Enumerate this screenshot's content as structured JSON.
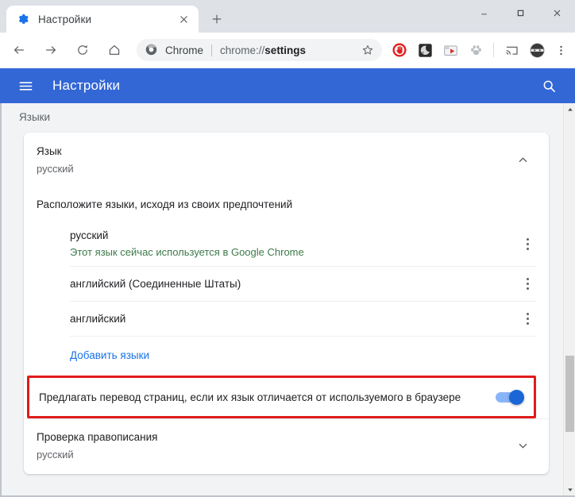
{
  "window": {
    "minimize_label": "—",
    "maximize_label": "□",
    "close_label": "×"
  },
  "tabstrip": {
    "tab": {
      "title": "Настройки",
      "favicon_name": "settings-gear-favicon",
      "close_label": "×"
    },
    "new_tab_label": "+"
  },
  "toolbar": {
    "back_label": "←",
    "forward_label": "→",
    "reload_label": "⟳",
    "home_label": "⌂",
    "omnibox": {
      "site_icon_name": "chrome-logo-icon",
      "site_label": "Chrome",
      "url_prefix": "chrome://",
      "url_bold": "settings",
      "url_full": "chrome://settings",
      "star_label": "☆"
    },
    "extensions": [
      {
        "name": "adblock-extension-icon",
        "color": "#e02020"
      },
      {
        "name": "dark-reader-extension-icon",
        "color": "#2b2b2b"
      },
      {
        "name": "screenshot-extension-icon",
        "color": "#d93025"
      },
      {
        "name": "paw-extension-icon",
        "color": "#9aa0a6"
      }
    ],
    "cast_icon_name": "cast-icon",
    "profile_icon_name": "profile-avatar-icon",
    "menu_label": "⋮"
  },
  "settings_header": {
    "menu_icon_name": "hamburger-menu-icon",
    "title": "Настройки",
    "search_icon_name": "search-icon",
    "accent_color": "#3367d6"
  },
  "page": {
    "section_title": "Языки",
    "language_card": {
      "title": "Язык",
      "subtitle": "русский",
      "collapse_icon_name": "chevron-up-icon",
      "order_hint": "Расположите языки, исходя из своих предпочтений",
      "languages": [
        {
          "name": "русский",
          "note": "Этот язык сейчас используется в Google Chrome",
          "note_color": "#3d7a4a",
          "menu_icon_name": "more-vert-icon"
        },
        {
          "name": "английский (Соединенные Штаты)",
          "note": "",
          "menu_icon_name": "more-vert-icon"
        },
        {
          "name": "английский",
          "note": "",
          "menu_icon_name": "more-vert-icon"
        }
      ],
      "add_language_link": "Добавить языки"
    },
    "translate_setting": {
      "label": "Предлагать перевод страниц, если их язык отличается от используемого в браузере",
      "toggle_state": "on",
      "toggle_track_color": "#8ab4f8",
      "toggle_knob_color": "#1a66d6",
      "highlight_color": "#e01b1b"
    },
    "spellcheck_card": {
      "title": "Проверка правописания",
      "subtitle": "русский",
      "expand_icon_name": "chevron-down-icon"
    }
  },
  "scrollbar": {
    "up_arrow_label": "▲",
    "down_arrow_label": "▼"
  }
}
